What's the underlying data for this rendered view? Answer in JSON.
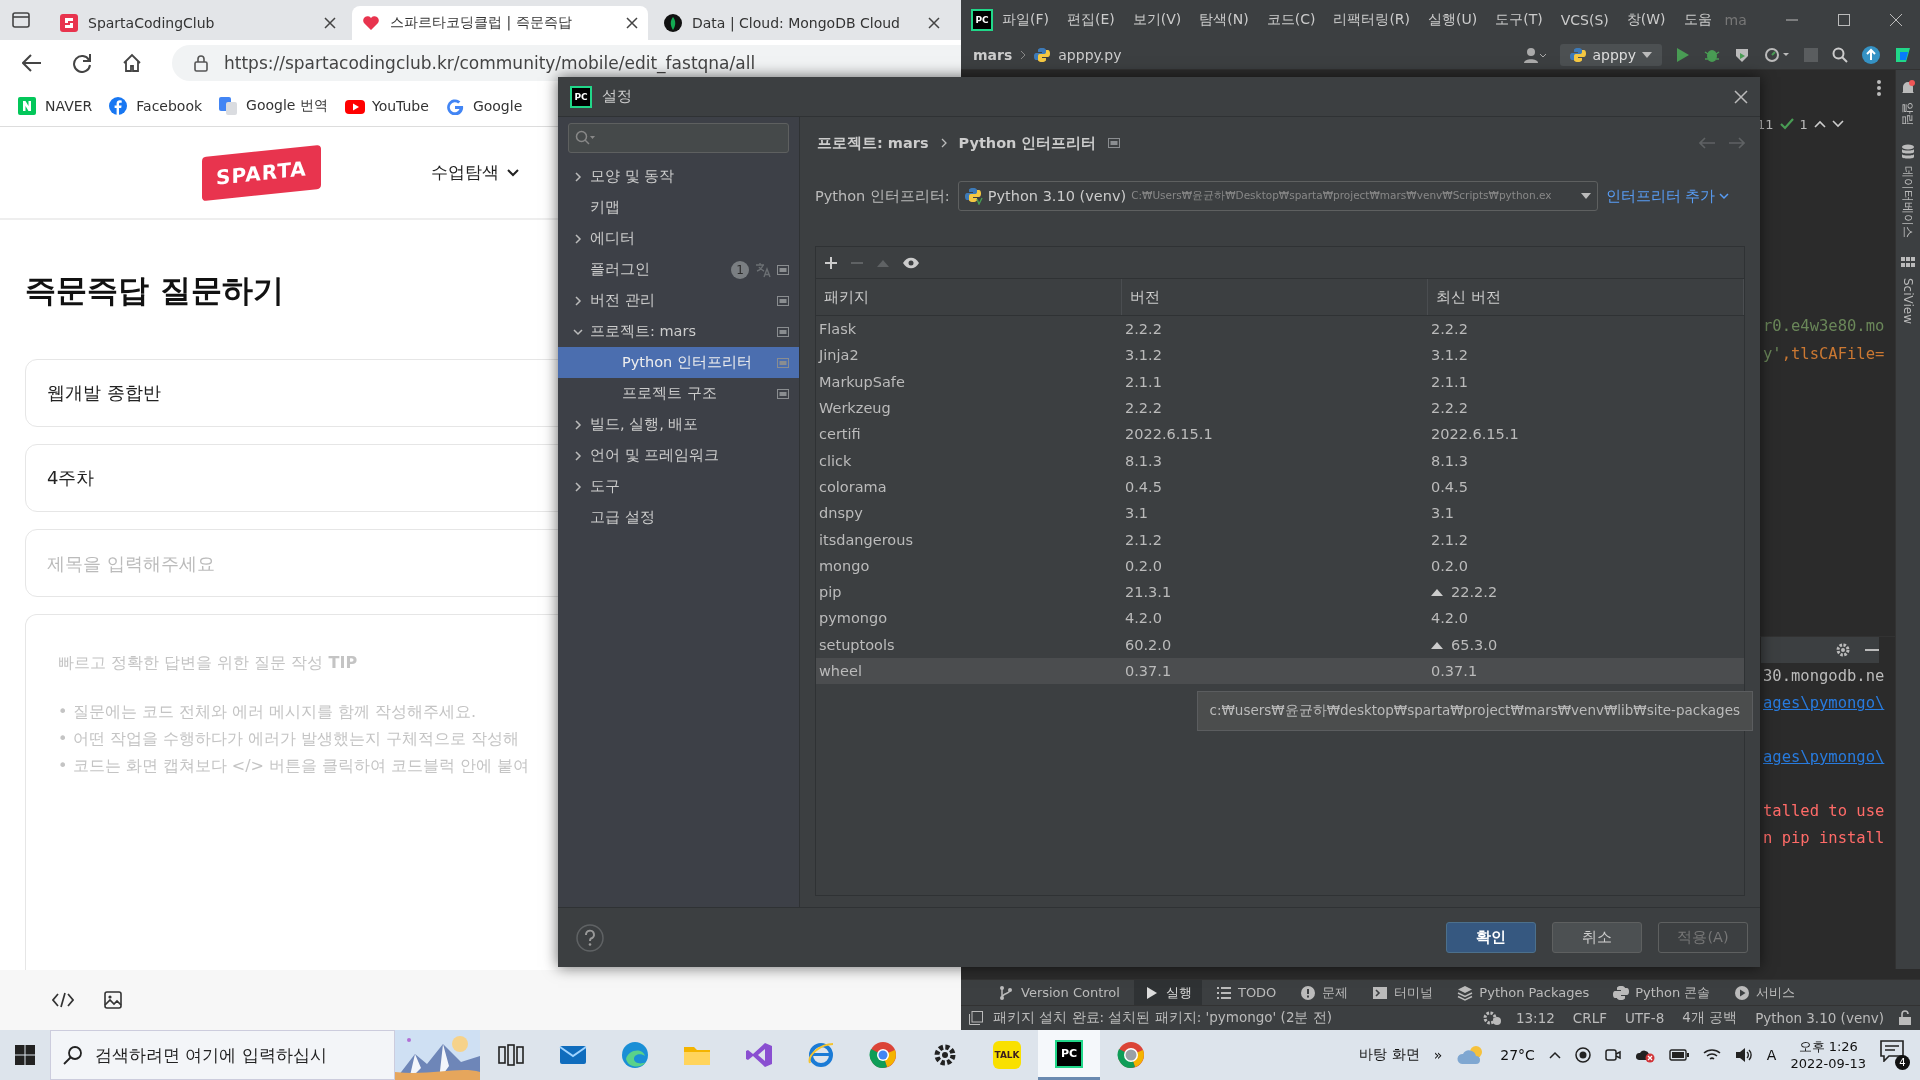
{
  "browser": {
    "tabs": [
      {
        "title": "SpartaCodingClub",
        "selected": false
      },
      {
        "title": "스파르타코딩클럽 | 즉문즉답",
        "selected": true
      },
      {
        "title": "Data | Cloud: MongoDB Cloud",
        "selected": false
      }
    ],
    "url": "https://spartacodingclub.kr/community/mobile/edit_fastqna/all",
    "bookmarks": [
      "NAVER",
      "Facebook",
      "Google 번역",
      "YouTube",
      "Google"
    ],
    "page": {
      "logo_text": "SPARTA",
      "nav_label": "수업탐색",
      "title": "즉문즉답 질문하기",
      "fields": [
        {
          "value": "웹개발 종합반"
        },
        {
          "value": "4주차"
        },
        {
          "placeholder": "제목을 입력해주세요"
        }
      ],
      "tip_title": "빠르고 정확한 답변을 위한 질문 작성 **TIP**",
      "tips": [
        "• 질문에는 코드 전체와 에러 메시지를 함께 작성해주세요.",
        "• 어떤 작업을 수행하다가 에러가 발생했는지 구체적으로 작성해",
        "• 코드는 화면 캡쳐보다 </> 버튼을 클릭하여 코드블럭 안에 붙여"
      ]
    }
  },
  "ide": {
    "logo_text": "PC",
    "menu": [
      "파일(F)",
      "편집(E)",
      "보기(V)",
      "탐색(N)",
      "코드(C)",
      "리팩터링(R)",
      "실행(U)",
      "도구(T)",
      "VCS(S)",
      "창(W)",
      "도움"
    ],
    "window_title": "ma",
    "breadcrumb": [
      "mars",
      "apppy.py"
    ],
    "run_config": "apppy",
    "warnings": "11",
    "passed": "1",
    "editor_lines": [
      [
        {
          "text": "r0.e4w3e80.mo",
          "kind": "string"
        }
      ],
      [
        {
          "text": "y'",
          "kind": "string"
        },
        {
          "text": ",tlsCAFile=",
          "kind": "keyword"
        }
      ]
    ],
    "run_lines": [
      {
        "text": "30.mongodb.ne",
        "kind": "plain"
      },
      {
        "text": "ages\\pymongo\\",
        "kind": "link"
      },
      {
        "text": "ages\\pymongo\\",
        "kind": "link"
      },
      {
        "text": "talled to use",
        "kind": "error"
      },
      {
        "text": "n pip install",
        "kind": "error"
      }
    ],
    "tool_stripe": [
      "알림",
      "데이터베이스",
      "SciView"
    ],
    "tool_tabs": [
      {
        "label": "Version Control",
        "selected": false
      },
      {
        "label": "실행",
        "selected": true
      },
      {
        "label": "TODO",
        "selected": false
      },
      {
        "label": "문제",
        "selected": false
      },
      {
        "label": "터미널",
        "selected": false
      },
      {
        "label": "Python Packages",
        "selected": false
      },
      {
        "label": "Python 콘솔",
        "selected": false
      },
      {
        "label": "서비스",
        "selected": false
      }
    ],
    "status": {
      "message": "패키지 설치 완료: 설치된 패키지: 'pymongo' (2분 전)",
      "items": [
        "13:12",
        "CRLF",
        "UTF-8",
        "4개 공백",
        "Python 3.10 (venv)"
      ]
    }
  },
  "dialog": {
    "logo_text": "PC",
    "title": "설정",
    "tree": [
      {
        "label": "모양 및 동작",
        "expanded": false,
        "selected": false,
        "project_scoped": false
      },
      {
        "label": "키맵",
        "selected": false,
        "project_scoped": false
      },
      {
        "label": "에디터",
        "expanded": false,
        "selected": false,
        "project_scoped": false
      },
      {
        "label": "플러그인",
        "selected": false,
        "project_scoped": true,
        "badge": "1"
      },
      {
        "label": "버전 관리",
        "expanded": false,
        "selected": false,
        "project_scoped": true
      },
      {
        "label": "프로젝트: mars",
        "expanded": true,
        "selected": false,
        "project_scoped": true,
        "children": [
          {
            "label": "Python 인터프리터",
            "selected": true,
            "project_scoped": true
          },
          {
            "label": "프로젝트 구조",
            "selected": false,
            "project_scoped": true
          }
        ]
      },
      {
        "label": "빌드, 실행, 배포",
        "expanded": false,
        "selected": false,
        "project_scoped": false
      },
      {
        "label": "언어 및 프레임워크",
        "expanded": false,
        "selected": false,
        "project_scoped": false
      },
      {
        "label": "도구",
        "expanded": false,
        "selected": false,
        "project_scoped": false
      },
      {
        "label": "고급 설정",
        "selected": false,
        "project_scoped": false
      }
    ],
    "breadcrumb": [
      "프로젝트: mars",
      "Python 인터프리터"
    ],
    "interpreter": {
      "label": "Python 인터프리터:",
      "name": "Python 3.10 (venv)",
      "path": "C:₩Users₩윤균하₩Desktop₩sparta₩project₩mars₩venv₩Scripts₩python.ex"
    },
    "add_link": "인터프리터 추가",
    "table": {
      "columns": [
        "패키지",
        "버전",
        "최신 버전"
      ],
      "rows": [
        {
          "name": "Flask",
          "version": "2.2.2",
          "latest": "2.2.2",
          "upgrade": false,
          "selected": false
        },
        {
          "name": "Jinja2",
          "version": "3.1.2",
          "latest": "3.1.2",
          "upgrade": false,
          "selected": false
        },
        {
          "name": "MarkupSafe",
          "version": "2.1.1",
          "latest": "2.1.1",
          "upgrade": false,
          "selected": false
        },
        {
          "name": "Werkzeug",
          "version": "2.2.2",
          "latest": "2.2.2",
          "upgrade": false,
          "selected": false
        },
        {
          "name": "certifi",
          "version": "2022.6.15.1",
          "latest": "2022.6.15.1",
          "upgrade": false,
          "selected": false
        },
        {
          "name": "click",
          "version": "8.1.3",
          "latest": "8.1.3",
          "upgrade": false,
          "selected": false
        },
        {
          "name": "colorama",
          "version": "0.4.5",
          "latest": "0.4.5",
          "upgrade": false,
          "selected": false
        },
        {
          "name": "dnspy",
          "version": "3.1",
          "latest": "3.1",
          "upgrade": false,
          "selected": false
        },
        {
          "name": "itsdangerous",
          "version": "2.1.2",
          "latest": "2.1.2",
          "upgrade": false,
          "selected": false
        },
        {
          "name": "mongo",
          "version": "0.2.0",
          "latest": "0.2.0",
          "upgrade": false,
          "selected": false
        },
        {
          "name": "pip",
          "version": "21.3.1",
          "latest": "22.2.2",
          "upgrade": true,
          "selected": false
        },
        {
          "name": "pymongo",
          "version": "4.2.0",
          "latest": "4.2.0",
          "upgrade": false,
          "selected": false
        },
        {
          "name": "setuptools",
          "version": "60.2.0",
          "latest": "65.3.0",
          "upgrade": true,
          "selected": false
        },
        {
          "name": "wheel",
          "version": "0.37.1",
          "latest": "0.37.1",
          "upgrade": false,
          "selected": true
        }
      ]
    },
    "tooltip": "c:₩users₩윤균하₩desktop₩sparta₩project₩mars₩venv₩lib₩site-packages",
    "buttons": [
      {
        "label": "확인",
        "kind": "primary",
        "disabled": false
      },
      {
        "label": "취소",
        "kind": "normal",
        "disabled": false
      },
      {
        "label": "적용(A)",
        "kind": "normal",
        "disabled": true
      }
    ]
  },
  "taskbar": {
    "search_placeholder": "검색하려면 여기에 입력하십시",
    "apps": [
      {
        "selected": false
      },
      {
        "selected": false
      },
      {
        "selected": false
      },
      {
        "selected": false
      },
      {
        "selected": false
      },
      {
        "selected": false
      },
      {
        "selected": false
      },
      {
        "selected": false
      },
      {
        "selected": false,
        "label": "TALK"
      },
      {
        "selected": true,
        "label": "PC"
      },
      {
        "selected": false
      }
    ],
    "desktop_label": "바탕 화면",
    "more": "»",
    "temperature": "27°C",
    "ime": "A",
    "time": "오후 1:26",
    "date": "2022-09-13",
    "notifications": "4"
  }
}
